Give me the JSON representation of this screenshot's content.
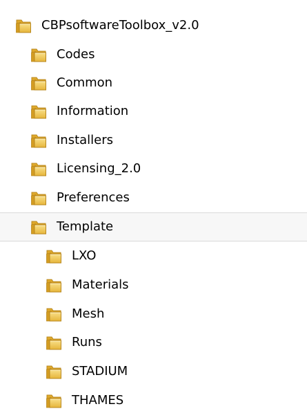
{
  "tree": {
    "root": {
      "label": "CBPsoftwareToolbox_v2.0",
      "icon": "folder-icon"
    },
    "children": [
      {
        "label": "Codes",
        "icon": "folder-icon"
      },
      {
        "label": "Common",
        "icon": "folder-icon"
      },
      {
        "label": "Information",
        "icon": "folder-icon"
      },
      {
        "label": "Installers",
        "icon": "folder-icon"
      },
      {
        "label": "Licensing_2.0",
        "icon": "folder-icon"
      },
      {
        "label": "Preferences",
        "icon": "folder-icon"
      },
      {
        "label": "Template",
        "icon": "folder-icon",
        "selected": true,
        "children": [
          {
            "label": "LXO",
            "icon": "folder-icon"
          },
          {
            "label": "Materials",
            "icon": "folder-icon"
          },
          {
            "label": "Mesh",
            "icon": "folder-icon"
          },
          {
            "label": "Runs",
            "icon": "folder-icon"
          },
          {
            "label": "STADIUM",
            "icon": "folder-icon"
          },
          {
            "label": "THAMES",
            "icon": "folder-icon"
          }
        ]
      }
    ]
  },
  "colors": {
    "folder_body": "#e8b93a",
    "folder_front": "#f6d873",
    "folder_edge": "#b8871d",
    "selection_bg": "#f7f7f7",
    "selection_border": "#d9d9d9"
  }
}
